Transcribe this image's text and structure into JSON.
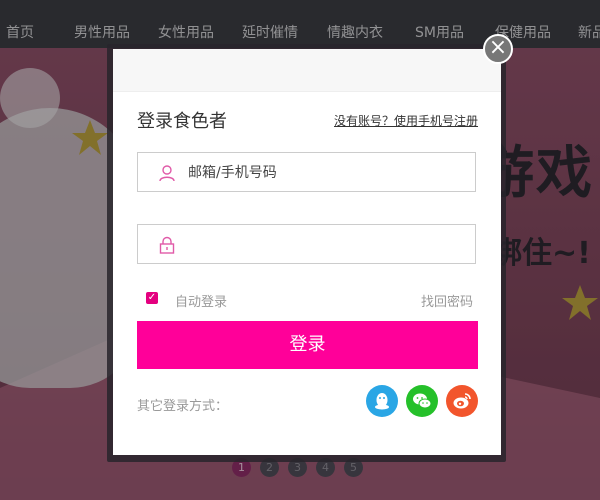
{
  "nav": {
    "items": [
      "首页",
      "男性用品",
      "女性用品",
      "延时催情",
      "情趣内衣",
      "SM用品",
      "保健用品",
      "新品"
    ]
  },
  "banner": {
    "headline": "游戏",
    "subline": "绑住~!",
    "pager": [
      "1",
      "2",
      "3",
      "4",
      "5"
    ],
    "active_page": "1"
  },
  "modal": {
    "title": "登录食色者",
    "register_link": "没有账号？使用手机号注册",
    "username_placeholder": "邮箱/手机号码",
    "password_placeholder": "",
    "remember_label": "自动登录",
    "remember_checked": true,
    "forgot_link": "找回密码",
    "login_button": "登录",
    "other_login_label": "其它登录方式：",
    "social": [
      {
        "name": "qq",
        "icon": "qq-icon",
        "color": "#2aa6e5"
      },
      {
        "name": "wechat",
        "icon": "wechat-icon",
        "color": "#25c02a"
      },
      {
        "name": "weibo",
        "icon": "weibo-icon",
        "color": "#f2552c"
      }
    ],
    "accent_color": "#ff0099"
  }
}
